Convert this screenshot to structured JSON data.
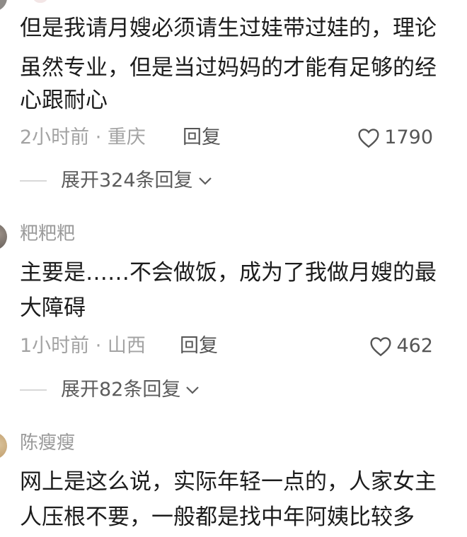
{
  "comments": [
    {
      "text_lines": [
        "但是我请月嫂必须请生过娃带过娃的，理论",
        "虽然专业，但是当过妈妈的才能有足够的经",
        "心跟耐心"
      ],
      "time": "2小时前 · 重庆",
      "reply_label": "回复",
      "likes": "1790",
      "expand_label": "展开324条回复"
    },
    {
      "username": "粑粑粑",
      "text_lines": [
        "主要是……不会做饭，成为了我做月嫂的最",
        "大障碍"
      ],
      "time": "1小时前 · 山西",
      "reply_label": "回复",
      "likes": "462",
      "expand_label": "展开82条回复"
    },
    {
      "username": "陈瘦瘦",
      "text_lines": [
        "网上是这么说，实际年轻一点的，人家女主",
        "人压根不要，一般都是找中年阿姨比较多"
      ]
    }
  ]
}
